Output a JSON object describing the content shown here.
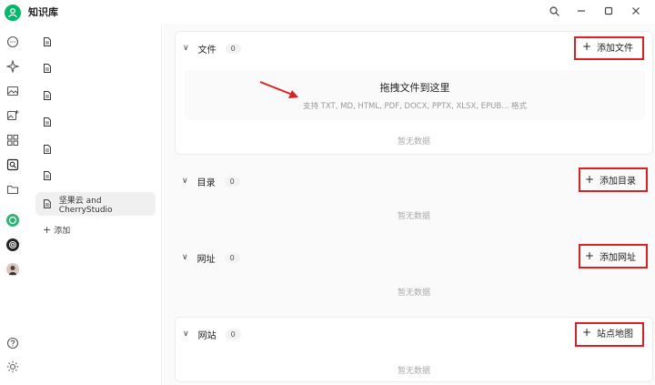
{
  "app": {
    "title": "知识库"
  },
  "window_controls": {
    "search": "⌕",
    "minimize": "─",
    "maximize": "☐",
    "close": "✕"
  },
  "nav": {
    "items": [
      {
        "label": ""
      },
      {
        "label": ""
      },
      {
        "label": ""
      },
      {
        "label": ""
      },
      {
        "label": ""
      },
      {
        "label": ""
      },
      {
        "label": "坚果云 and CherryStudio"
      }
    ],
    "add_label": "添加"
  },
  "sections": {
    "files": {
      "title": "文件",
      "count": "0",
      "add_label": "添加文件",
      "drop_title": "拖拽文件到这里",
      "drop_subtitle": "支持 TXT, MD, HTML, PDF, DOCX, PPTX, XLSX, EPUB... 格式",
      "empty": "暂无数据"
    },
    "directory": {
      "title": "目录",
      "count": "0",
      "add_label": "添加目录",
      "empty": "暂无数据"
    },
    "url": {
      "title": "网址",
      "count": "0",
      "add_label": "添加网址",
      "empty": "暂无数据"
    },
    "site": {
      "title": "网站",
      "count": "0",
      "add_label": "站点地图",
      "empty": "暂无数据"
    }
  },
  "colors": {
    "accent": "#00b96b",
    "highlight": "#e02020"
  }
}
